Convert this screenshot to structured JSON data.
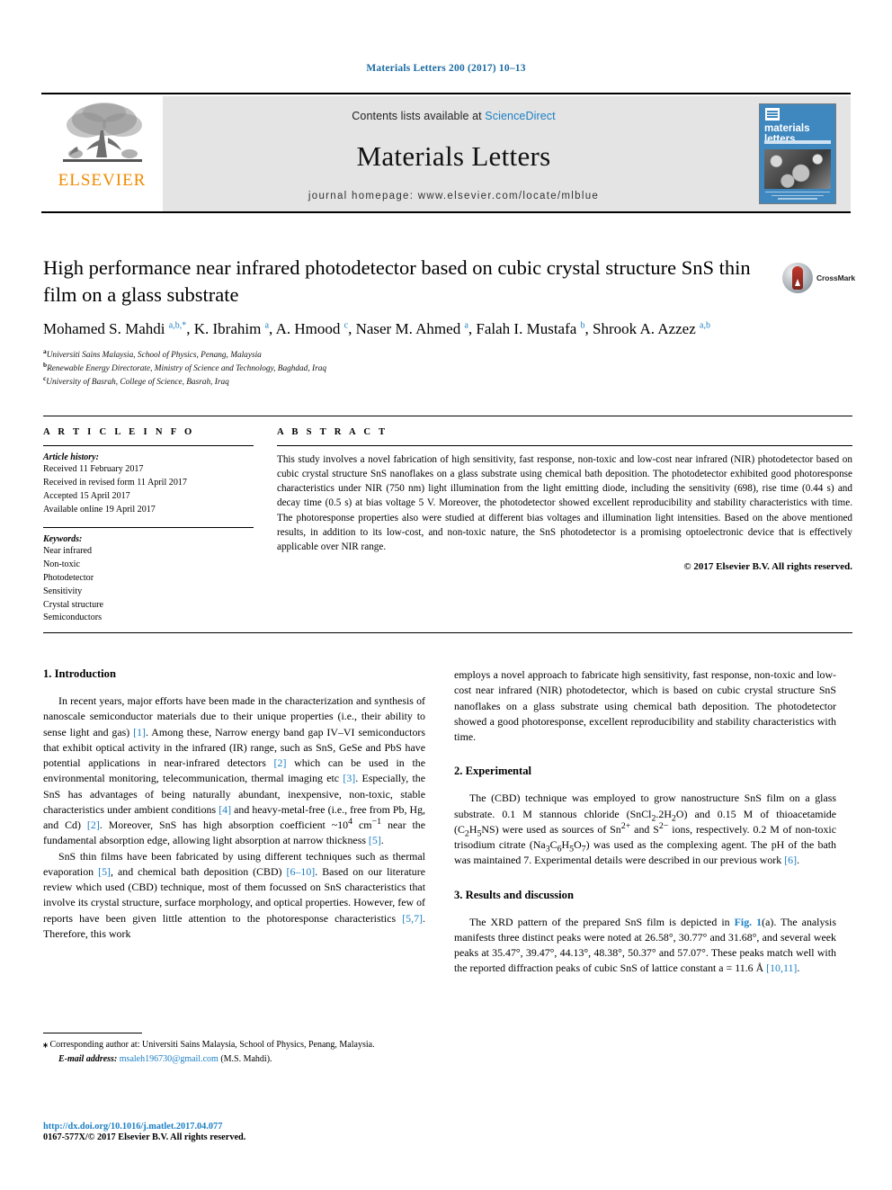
{
  "running_head": "Materials Letters 200 (2017) 10–13",
  "masthead": {
    "publisher_name": "ELSEVIER",
    "contents_prefix": "Contents lists available at ",
    "contents_link": "ScienceDirect",
    "journal_title": "Materials Letters",
    "homepage": "journal homepage: www.elsevier.com/locate/mlblue",
    "cover_title": "materials letters"
  },
  "article": {
    "title": "High performance near infrared photodetector based on cubic crystal structure SnS thin film on a glass substrate",
    "crossmark_label": "CrossMark",
    "authors_html": "Mohamed S. Mahdi <sup>a,b,</sup><sup>*</sup>, K. Ibrahim <sup>a</sup>, A. Hmood <sup>c</sup>, Naser M. Ahmed <sup>a</sup>, Falah I. Mustafa <sup>b</sup>, Shrook A. Azzez <sup>a,b</sup>",
    "affiliations": [
      {
        "marker": "a",
        "text": "Universiti Sains Malaysia, School of Physics, Penang, Malaysia"
      },
      {
        "marker": "b",
        "text": "Renewable Energy Directorate, Ministry of Science and Technology, Baghdad, Iraq"
      },
      {
        "marker": "c",
        "text": "University of Basrah, College of Science, Basrah, Iraq"
      }
    ]
  },
  "article_info": {
    "heading": "A R T I C L E  I N F O",
    "history_label": "Article history:",
    "history": [
      "Received 11 February 2017",
      "Received in revised form 11 April 2017",
      "Accepted 15 April 2017",
      "Available online 19 April 2017"
    ],
    "keywords_label": "Keywords:",
    "keywords": [
      "Near infrared",
      "Non-toxic",
      "Photodetector",
      "Sensitivity",
      "Crystal structure",
      "Semiconductors"
    ]
  },
  "abstract": {
    "heading": "A B S T R A C T",
    "text": "This study involves a novel fabrication of high sensitivity, fast response, non-toxic and low-cost near infrared (NIR) photodetector based on cubic crystal structure SnS nanoflakes on a glass substrate using chemical bath deposition. The photodetector exhibited good photoresponse characteristics under NIR (750 nm) light illumination from the light emitting diode, including the sensitivity (698), rise time (0.44 s) and decay time (0.5 s) at bias voltage 5 V. Moreover, the photodetector showed excellent reproducibility and stability characteristics with time. The photoresponse properties also were studied at different bias voltages and illumination light intensities. Based on the above mentioned results, in addition to its low-cost, and non-toxic nature, the SnS photodetector is a promising optoelectronic device that is effectively applicable over NIR range.",
    "copyright": "© 2017 Elsevier B.V. All rights reserved."
  },
  "sections": {
    "introduction": {
      "heading": "1. Introduction",
      "p1_html": "In recent years, major efforts have been made in the characterization and synthesis of nanoscale semiconductor materials due to their unique properties (i.e., their ability to sense light and gas) <span class=\"ref\">[1]</span>. Among these, Narrow energy band gap IV–VI semiconductors that exhibit optical activity in the infrared (IR) range, such as SnS, GeSe and PbS have potential applications in near-infrared detectors <span class=\"ref\">[2]</span> which can be used in the environmental monitoring, telecommunication, thermal imaging etc <span class=\"ref\">[3]</span>. Especially, the SnS has advantages of being naturally abundant, inexpensive, non-toxic, stable characteristics under ambient conditions <span class=\"ref\">[4]</span> and heavy-metal-free (i.e., free from Pb, Hg, and Cd) <span class=\"ref\">[2]</span>. Moreover, SnS has high absorption coefficient ~10<sup>4</sup> cm<sup>−1</sup> near the fundamental absorption edge, allowing light absorption at narrow thickness <span class=\"ref\">[5]</span>.",
      "p2_html": "SnS thin films have been fabricated by using different techniques such as thermal evaporation <span class=\"ref\">[5]</span>, and chemical bath deposition (CBD) <span class=\"ref\">[6–10]</span>. Based on our literature review which used (CBD) technique, most of them focussed on SnS characteristics that involve its crystal structure, surface morphology, and optical properties. However, few of reports have been given little attention to the photoresponse characteristics <span class=\"ref\">[5,7]</span>. Therefore, this work",
      "p2_cont_html": "employs a novel approach to fabricate high sensitivity, fast response, non-toxic and low-cost near infrared (NIR) photodetector, which is based on cubic crystal structure SnS nanoflakes on a glass substrate using chemical bath deposition. The photodetector showed a good photoresponse, excellent reproducibility and stability characteristics with time."
    },
    "experimental": {
      "heading": "2. Experimental",
      "p1_html": "The (CBD) technique was employed to grow nanostructure SnS film on a glass substrate. 0.1 M stannous chloride (SnCl<sub>2</sub>.2H<sub>2</sub>O) and 0.15 M of thioacetamide (C<sub>2</sub>H<sub>5</sub>NS) were used as sources of Sn<sup>2+</sup> and S<sup>2−</sup> ions, respectively. 0.2 M of non-toxic trisodium citrate (Na<sub>3</sub>C<sub>6</sub>H<sub>5</sub>O<sub>7</sub>) was used as the complexing agent. The pH of the bath was maintained 7. Experimental details were described in our previous work <span class=\"ref\">[6]</span>."
    },
    "results": {
      "heading": "3. Results and discussion",
      "p1_html": "The XRD pattern of the prepared SnS film is depicted in <span class=\"ref-b\">Fig. 1</span>(a). The analysis manifests three distinct peaks were noted at 26.58°, 30.77° and 31.68°, and several week peaks at 35.47°, 39.47°, 44.13°, 48.38°, 50.37° and 57.07°. These peaks match well with the reported diffraction peaks of cubic SnS of lattice constant a = 11.6 Å <span class=\"ref\">[10,11]</span>."
    }
  },
  "footer": {
    "corresponding_html": "<b>⁎</b> Corresponding author at: Universiti Sains Malaysia, School of Physics, Penang, Malaysia.",
    "email_label": "E-mail address:",
    "email": "msaleh196730@gmail.com",
    "email_suffix": " (M.S. Mahdi).",
    "doi": "http://dx.doi.org/10.1016/j.matlet.2017.04.077",
    "issn_line": "0167-577X/© 2017 Elsevier B.V. All rights reserved."
  },
  "colors": {
    "link_blue": "#1b7fc4",
    "elsevier_orange": "#f08a00",
    "cover_blue": "#3e87bf",
    "masthead_gray": "#e4e4e4"
  }
}
